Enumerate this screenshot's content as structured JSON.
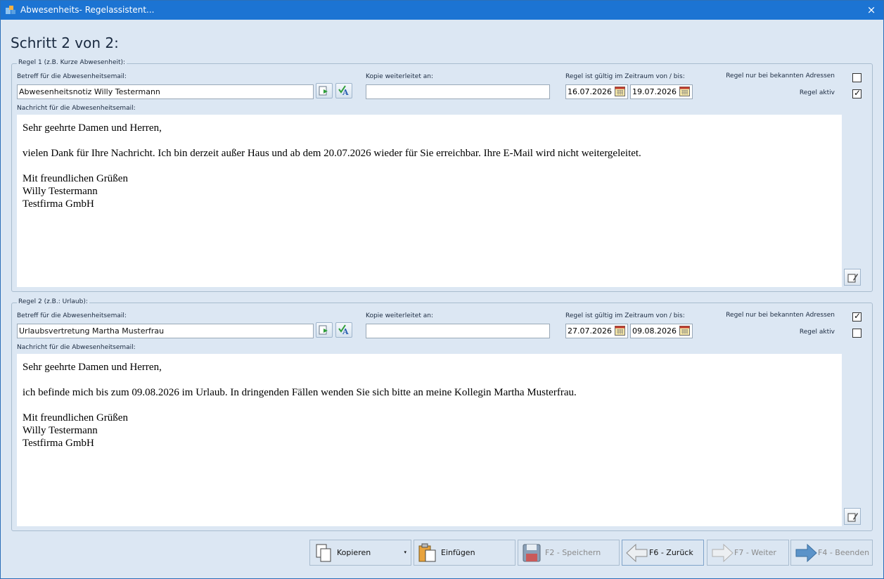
{
  "window": {
    "title": "Abwesenheits- Regelassistent...",
    "close_icon": "×"
  },
  "step_title": "Schritt 2 von 2:",
  "labels": {
    "subject": "Betreff für die Abwesenheitsemail:",
    "copy_forward": "Kopie weiterleitet an:",
    "validity": "Regel ist gültig im Zeitraum von / bis:",
    "known_only": "Regel nur bei bekannten Adressen",
    "active": "Regel aktiv",
    "message": "Nachricht für die Abwesenheitsemail:"
  },
  "rules": [
    {
      "legend": "Regel 1 (z.B. Kurze Abwesenheit):",
      "subject": "Abwesenheitsnotiz Willy Testermann",
      "copy_to": "",
      "date_from": "16.07.2026",
      "date_to": "19.07.2026",
      "known_only": false,
      "active": true,
      "message": {
        "greeting": "Sehr geehrte Damen und Herren,",
        "body": "vielen Dank für Ihre Nachricht. Ich bin derzeit außer Haus und ab dem 20.07.2026 wieder für Sie erreichbar. Ihre E-Mail wird nicht weitergeleitet.",
        "closing": "Mit freundlichen Grüßen",
        "name": "Willy Testermann",
        "company": "Testfirma GmbH"
      }
    },
    {
      "legend": "Regel 2 (z.B.: Urlaub):",
      "subject": "Urlaubsvertretung Martha Musterfrau",
      "copy_to": "",
      "date_from": "27.07.2026",
      "date_to": "09.08.2026",
      "known_only": true,
      "active": false,
      "message": {
        "greeting": "Sehr geehrte Damen und Herren,",
        "body": "ich befinde mich bis zum 09.08.2026 im Urlaub. In dringenden Fällen wenden Sie sich bitte an meine Kollegin Martha Musterfrau.",
        "closing": "Mit freundlichen Grüßen",
        "name": "Willy Testermann",
        "company": "Testfirma GmbH"
      }
    }
  ],
  "footer": {
    "copy": "Kopieren",
    "paste": "Einfügen",
    "save": "F2 - Speichern",
    "back": "F6 - Zurück",
    "next": "F7 - Weiter",
    "finish": "F4 - Beenden",
    "dropdown_glyph": "▾"
  },
  "tick_glyph": "✓",
  "colors": {
    "titlebar": "#1c74d3",
    "background": "#dce7f3"
  }
}
